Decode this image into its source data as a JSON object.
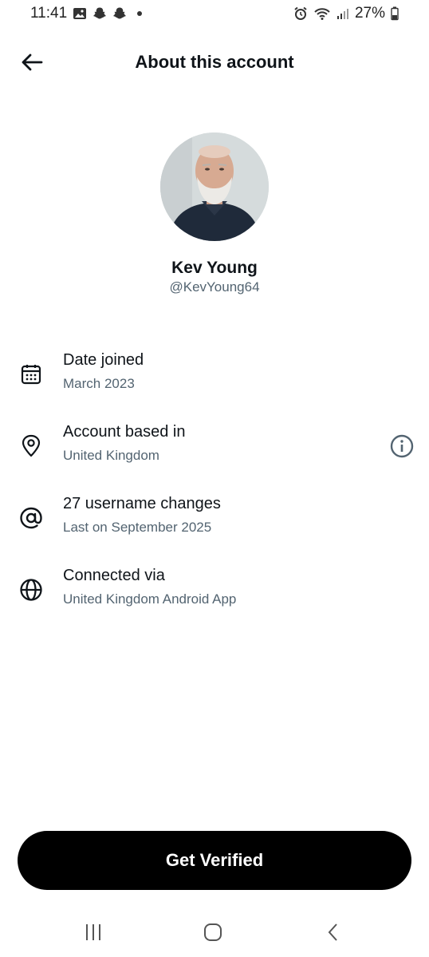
{
  "status_bar": {
    "time": "11:41",
    "battery": "27%",
    "icons": [
      "gallery-icon",
      "snapchat-icon",
      "snapchat-icon",
      "dot-icon",
      "alarm-icon",
      "wifi-icon",
      "signal-icon",
      "battery-icon"
    ]
  },
  "header": {
    "title": "About this account",
    "back_icon": "arrow-left-icon"
  },
  "profile": {
    "display_name": "Kev Young",
    "handle": "@KevYoung64"
  },
  "info_rows": [
    {
      "icon": "calendar-icon",
      "title": "Date joined",
      "subtitle": "March 2023"
    },
    {
      "icon": "location-pin-icon",
      "title": "Account based in",
      "subtitle": "United Kingdom",
      "action_icon": "info-icon"
    },
    {
      "icon": "at-sign-icon",
      "title": "27 username changes",
      "subtitle": "Last on September 2025"
    },
    {
      "icon": "globe-icon",
      "title": "Connected via",
      "subtitle": "United Kingdom Android App"
    }
  ],
  "cta": {
    "label": "Get Verified"
  },
  "nav_bar": {
    "buttons": [
      "recent-apps-icon",
      "home-icon",
      "back-icon"
    ]
  },
  "colors": {
    "primary_text": "#0f1419",
    "secondary_text": "#536471",
    "cta_background": "#000000",
    "cta_text": "#ffffff"
  }
}
